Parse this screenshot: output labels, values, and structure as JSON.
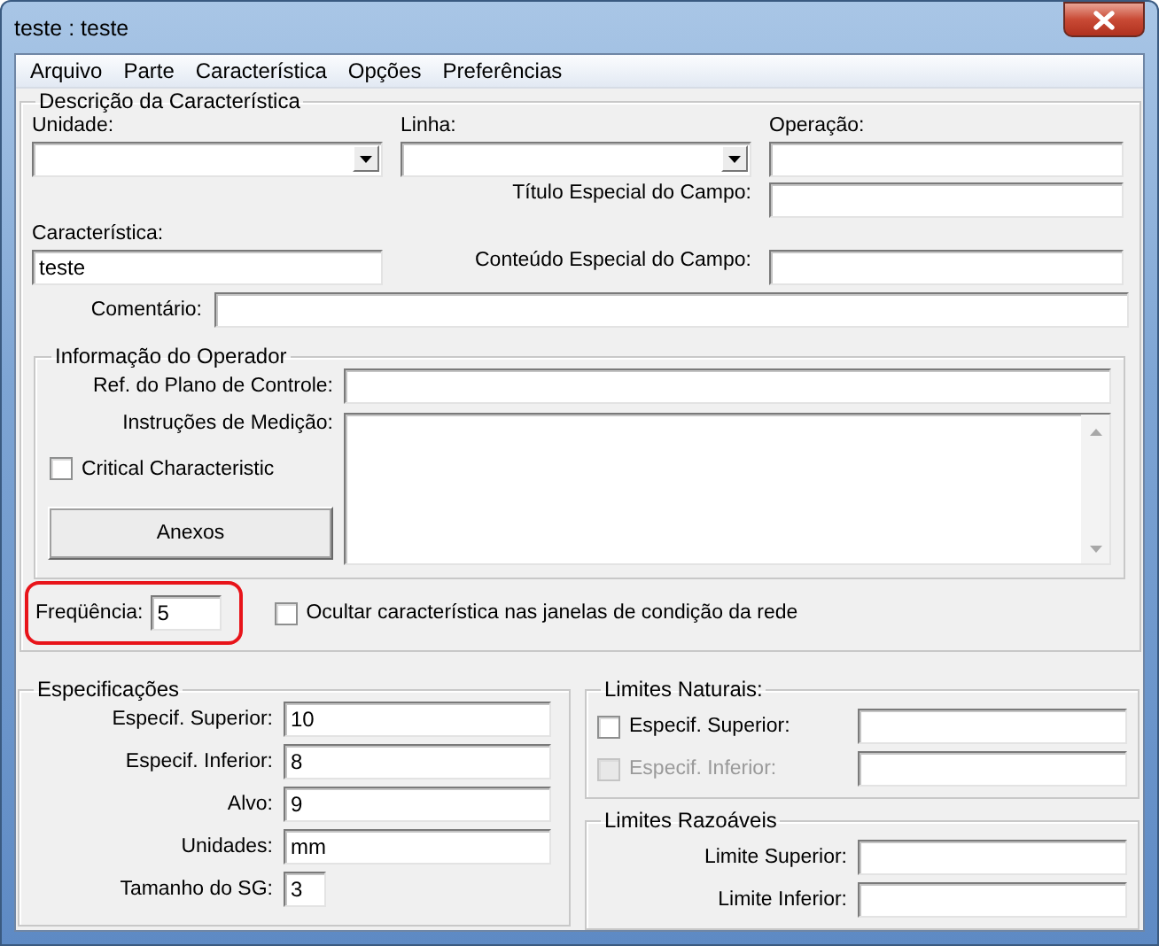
{
  "window": {
    "title": "teste : teste"
  },
  "menu": [
    "Arquivo",
    "Parte",
    "Característica",
    "Opções",
    "Preferências"
  ],
  "description": {
    "title": "Descrição da Característica",
    "unit": {
      "label": "Unidade:"
    },
    "line": {
      "label": "Linha:"
    },
    "operation": {
      "label": "Operação:"
    },
    "special_title": {
      "label": "Título Especial do Campo:"
    },
    "characteristic": {
      "label": "Característica:",
      "value": "teste"
    },
    "special_content": {
      "label": "Conteúdo Especial do Campo:"
    },
    "comment": {
      "label": "Comentário:"
    },
    "operator_info": {
      "title": "Informação do Operador",
      "control_plan_ref": {
        "label": "Ref. do Plano de Controle:"
      },
      "measurement_instructions": {
        "label": "Instruções de Medição:"
      },
      "critical_characteristic": {
        "label": "Critical Characteristic",
        "checked": false
      },
      "attachments_button": "Anexos"
    },
    "frequency": {
      "label": "Freqüência:",
      "value": "5",
      "highlighted": true
    },
    "hide_in_network": {
      "label": "Ocultar característica nas janelas de condição da rede",
      "checked": false
    }
  },
  "specifications": {
    "title": "Especificações",
    "fields": [
      {
        "label": "Especif. Superior:",
        "value": "10",
        "kind": "wide"
      },
      {
        "label": "Especif. Inferior:",
        "value": "8",
        "kind": "wide"
      },
      {
        "label": "Alvo:",
        "value": "9",
        "kind": "wide"
      },
      {
        "label": "Unidades:",
        "value": "mm",
        "kind": "wide"
      },
      {
        "label": "Tamanho do SG:",
        "value": "3",
        "kind": "short"
      }
    ]
  },
  "natural_limits": {
    "title": "Limites Naturais:",
    "rows": [
      {
        "label": "Especif. Superior:",
        "checked": false,
        "disabled": false
      },
      {
        "label": "Especif. Inferior:",
        "checked": false,
        "disabled": true
      }
    ]
  },
  "reasonable_limits": {
    "title": "Limites Razoáveis",
    "fields": [
      {
        "label": "Limite Superior:"
      },
      {
        "label": "Limite Inferior:"
      }
    ]
  }
}
